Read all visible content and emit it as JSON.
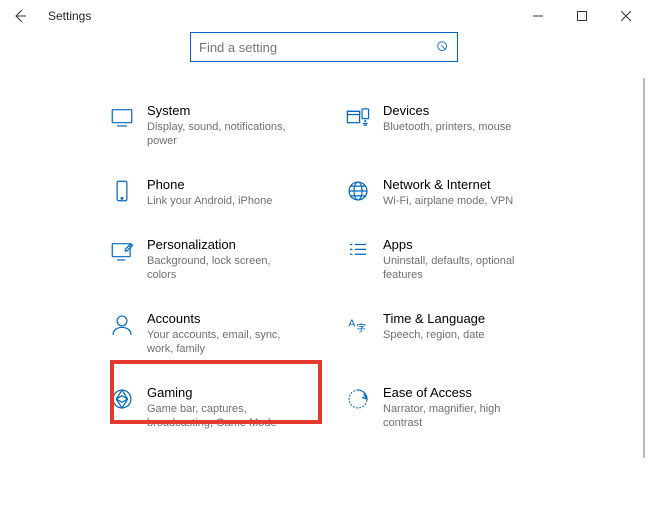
{
  "window": {
    "title": "Settings"
  },
  "search": {
    "placeholder": "Find a setting"
  },
  "tiles": [
    {
      "id": "system",
      "label": "System",
      "sub": "Display, sound, notifications, power"
    },
    {
      "id": "devices",
      "label": "Devices",
      "sub": "Bluetooth, printers, mouse"
    },
    {
      "id": "phone",
      "label": "Phone",
      "sub": "Link your Android, iPhone"
    },
    {
      "id": "network",
      "label": "Network & Internet",
      "sub": "Wi-Fi, airplane mode, VPN"
    },
    {
      "id": "personalization",
      "label": "Personalization",
      "sub": "Background, lock screen, colors"
    },
    {
      "id": "apps",
      "label": "Apps",
      "sub": "Uninstall, defaults, optional features"
    },
    {
      "id": "accounts",
      "label": "Accounts",
      "sub": "Your accounts, email, sync, work, family"
    },
    {
      "id": "time-language",
      "label": "Time & Language",
      "sub": "Speech, region, date"
    },
    {
      "id": "gaming",
      "label": "Gaming",
      "sub": "Game bar, captures, broadcasting, Game Mode"
    },
    {
      "id": "ease-of-access",
      "label": "Ease of Access",
      "sub": "Narrator, magnifier, high contrast"
    }
  ],
  "highlighted": "accounts",
  "colors": {
    "accent": "#0067c0",
    "highlight": "#e33a2f"
  }
}
